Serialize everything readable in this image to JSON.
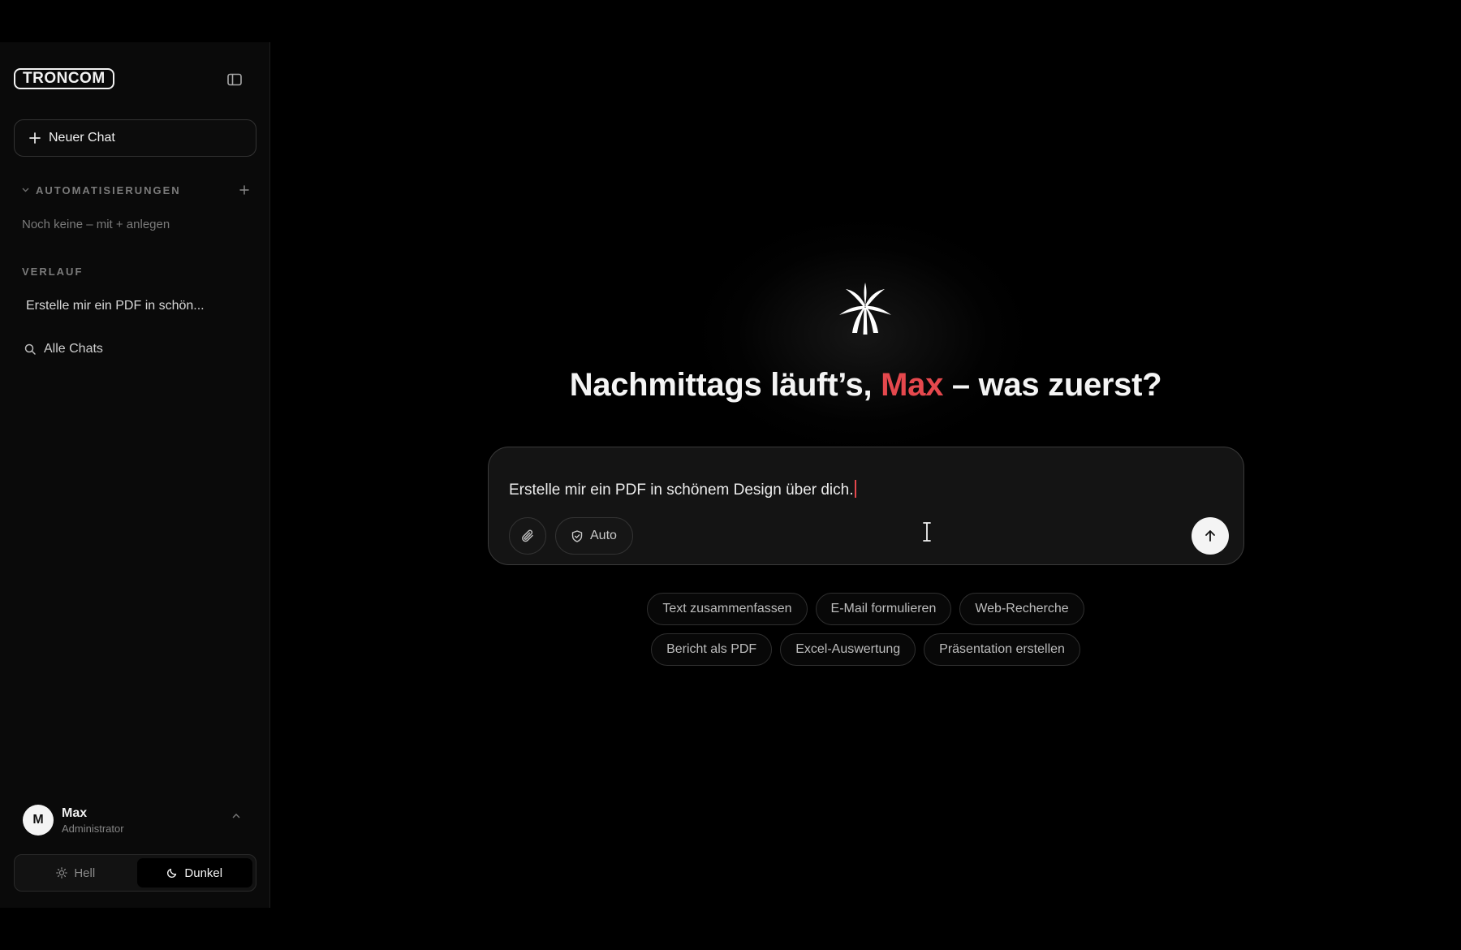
{
  "sidebar": {
    "logo": "TRONCOM",
    "new_chat_label": "Neuer Chat",
    "automations": {
      "label": "AUTOMATISIERUNGEN",
      "empty_text": "Noch keine – mit + anlegen"
    },
    "history": {
      "label": "VERLAUF",
      "items": [
        {
          "label": "Erstelle mir ein PDF in schön..."
        }
      ]
    },
    "all_chats_label": "Alle Chats",
    "user": {
      "initial": "M",
      "name": "Max",
      "role": "Administrator"
    },
    "theme": {
      "light_label": "Hell",
      "dark_label": "Dunkel",
      "selected": "Dunkel"
    }
  },
  "main": {
    "greeting": {
      "before": "Nachmittags läuft’s, ",
      "name": "Max",
      "after": " – was zuerst?"
    },
    "composer": {
      "value": "Erstelle mir ein PDF in schönem Design über dich.",
      "mode_label": "Auto"
    },
    "suggestions_row1": [
      "Text zusammenfassen",
      "E-Mail formulieren",
      "Web-Recherche"
    ],
    "suggestions_row2": [
      "Bericht als PDF",
      "Excel-Auswertung",
      "Präsentation erstellen"
    ]
  },
  "colors": {
    "accent": "#e5484d",
    "background": "#000000",
    "sidebar": "#0a0a0a"
  },
  "icons": {
    "logo_mark": "palm-icon",
    "sidebar_toggle": "sidebar-toggle-icon",
    "new_chat": "plus-icon",
    "search": "search-icon",
    "attach": "paperclip-icon",
    "mode": "shield-check-icon",
    "send": "arrow-up-icon"
  }
}
